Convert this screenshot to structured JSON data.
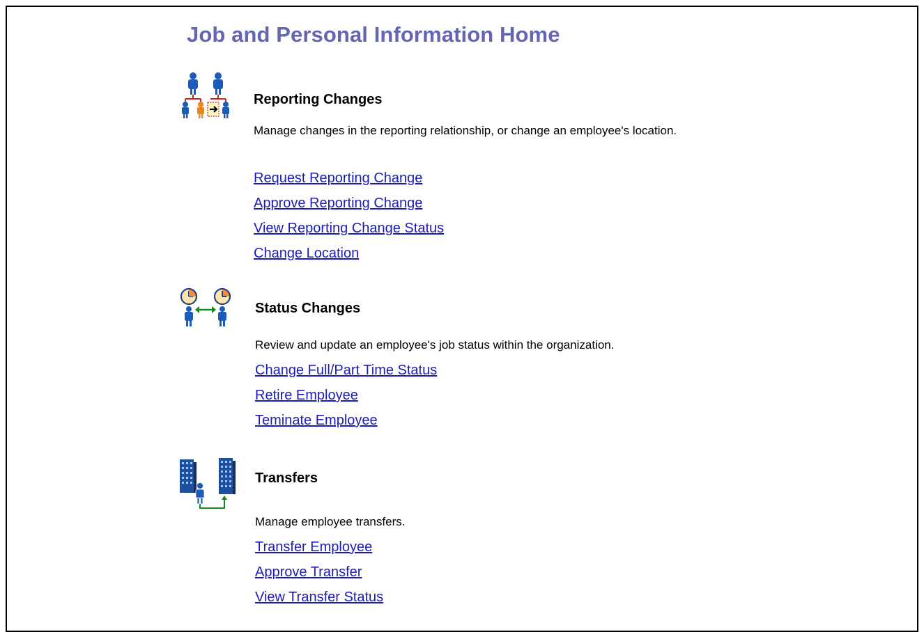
{
  "page": {
    "title": "Job and Personal Information Home"
  },
  "sections": [
    {
      "icon": "reporting-change-people-icon",
      "heading": "Reporting Changes",
      "description": "Manage changes in the reporting relationship, or change an employee's location.",
      "links": [
        "Request Reporting Change",
        "Approve Reporting Change",
        "View Reporting Change Status",
        "Change Location"
      ]
    },
    {
      "icon": "status-change-clocks-icon",
      "heading": "Status Changes",
      "description": "Review and update an employee's job status within the organization.",
      "links": [
        "Change Full/Part Time Status",
        "Retire Employee",
        "Teminate Employee"
      ]
    },
    {
      "icon": "transfer-buildings-icon",
      "heading": "Transfers",
      "description": "Manage employee transfers.",
      "links": [
        "Transfer Employee",
        "Approve Transfer",
        "View Transfer Status"
      ]
    }
  ],
  "colors": {
    "title": "#6467b0",
    "link": "#1c1cb8",
    "text": "#000000",
    "border": "#000000"
  }
}
